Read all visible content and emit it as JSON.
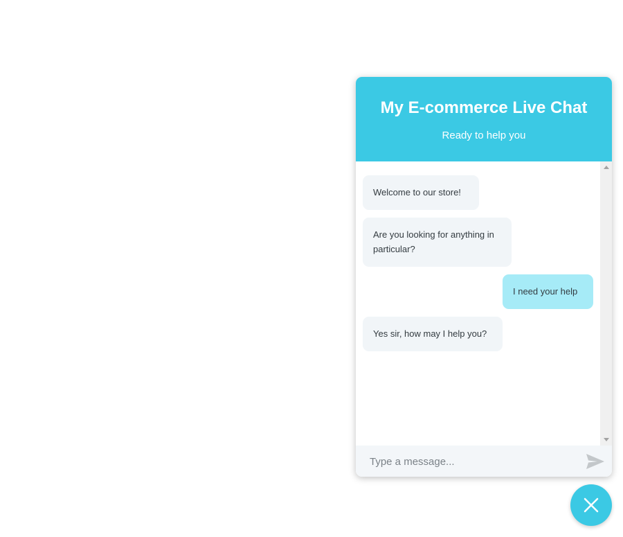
{
  "header": {
    "title": "My E-commerce Live Chat",
    "subtitle": "Ready to help you"
  },
  "messages": [
    {
      "sender": "bot",
      "text": "Welcome to our store!"
    },
    {
      "sender": "bot",
      "text": "Are you looking for anything in particular?"
    },
    {
      "sender": "user",
      "text": "I need your help"
    },
    {
      "sender": "bot",
      "text": "Yes sir, how may I help you?"
    }
  ],
  "composer": {
    "placeholder": "Type a message..."
  },
  "icons": {
    "send": "send-icon",
    "close": "close-icon"
  },
  "colors": {
    "accent": "#3bc9e4",
    "bot_bubble": "#f1f5f8",
    "user_bubble": "#a6ebf7"
  }
}
